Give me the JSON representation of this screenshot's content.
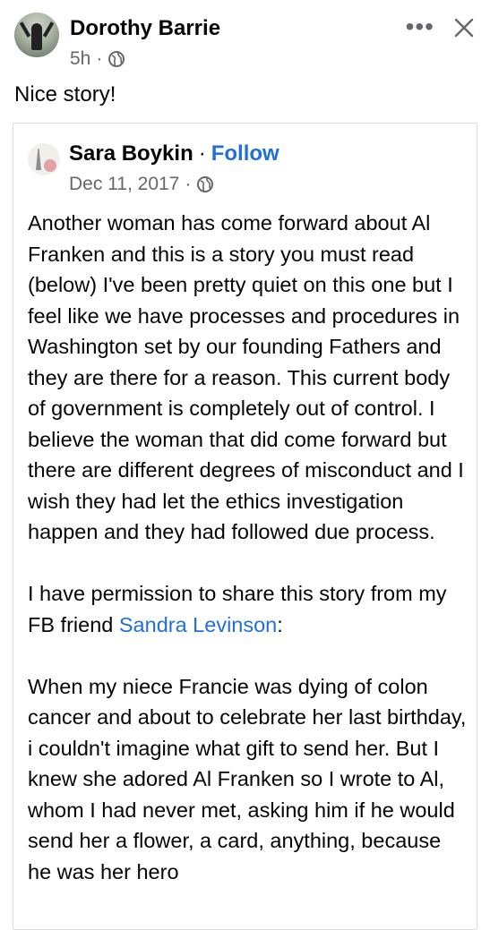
{
  "comment": {
    "author": "Dorothy Barrie",
    "time": "5h",
    "separator": "·",
    "text": "Nice story!"
  },
  "header_icons": {
    "more": "more-horizontal-icon",
    "close": "close-icon",
    "globe": "globe-icon"
  },
  "shared_post": {
    "author": "Sara Boykin",
    "separator": "·",
    "follow_label": "Follow",
    "date": "Dec 11, 2017",
    "paragraph1": "Another woman has come forward about Al Franken and this is a story you must read (below) I've been pretty quiet on this one but I feel like we have processes and procedures in Washington set by our founding Fathers and they are there for a reason. This current body of government is completely out of control. I believe the woman that did come forward but there are different degrees of misconduct and I wish they had let the ethics investigation happen and they had followed due process.",
    "paragraph2_prefix": "I have permission to share this story from my FB friend ",
    "paragraph2_link": "Sandra Levinson",
    "paragraph2_suffix": ":",
    "paragraph3": "When my niece Francie was dying of colon cancer and about to celebrate her last birthday, i couldn't imagine what gift to send her. But I knew she adored Al Franken so I wrote to Al, whom I had never met, asking him if he would send her a flower, a card, anything, because he was her hero"
  },
  "colors": {
    "link": "#216fdb",
    "meta_text": "#65676b",
    "card_border": "#dadde1"
  }
}
